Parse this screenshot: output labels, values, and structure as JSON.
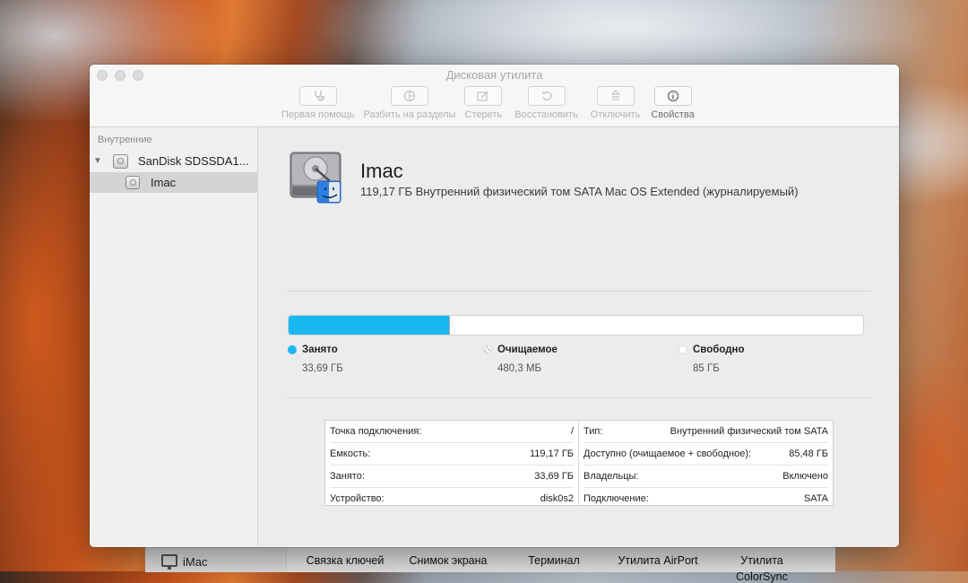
{
  "window": {
    "title": "Дисковая утилита"
  },
  "toolbar": {
    "items": [
      {
        "label": "Первая помощь",
        "icon": "stethoscope-icon"
      },
      {
        "label": "Разбить на разделы",
        "icon": "partition-icon"
      },
      {
        "label": "Стереть",
        "icon": "erase-icon"
      },
      {
        "label": "Восстановить",
        "icon": "restore-icon"
      },
      {
        "label": "Отключить",
        "icon": "unmount-icon"
      },
      {
        "label": "Свойства",
        "icon": "info-icon"
      }
    ]
  },
  "sidebar": {
    "section": "Внутренние",
    "disk": "SanDisk SDSSDA1...",
    "volume": "Imac"
  },
  "volume": {
    "name": "Imac",
    "description": "119,17 ГБ Внутренний физический том SATA Mac OS Extended (журналируемый)",
    "used_fraction": 0.28,
    "colors": {
      "used": "#19b8f3",
      "free": "#ffffff"
    }
  },
  "legend": {
    "used": {
      "label": "Занято",
      "value": "33,69 ГБ"
    },
    "purgeable": {
      "label": "Очищаемое",
      "value": "480,3 МБ"
    },
    "free": {
      "label": "Свободно",
      "value": "85 ГБ"
    }
  },
  "info": {
    "left": [
      {
        "k": "Точка подключения:",
        "v": "/"
      },
      {
        "k": "Емкость:",
        "v": "119,17 ГБ"
      },
      {
        "k": "Занято:",
        "v": "33,69 ГБ"
      },
      {
        "k": "Устройство:",
        "v": "disk0s2"
      }
    ],
    "right": [
      {
        "k": "Тип:",
        "v": "Внутренний физический том SATA"
      },
      {
        "k": "Доступно (очищаемое + свободное):",
        "v": "85,48 ГБ"
      },
      {
        "k": "Владельцы:",
        "v": "Включено"
      },
      {
        "k": "Подключение:",
        "v": "SATA"
      }
    ]
  },
  "background": {
    "sidebar_item": "iMac",
    "apps": [
      {
        "line1": "Связка ключей",
        "line2": ""
      },
      {
        "line1": "Снимок экрана",
        "line2": ""
      },
      {
        "line1": "Терминал",
        "line2": ""
      },
      {
        "line1": "Утилита AirPort",
        "line2": ""
      },
      {
        "line1": "Утилита",
        "line2": "ColorSync"
      }
    ]
  }
}
